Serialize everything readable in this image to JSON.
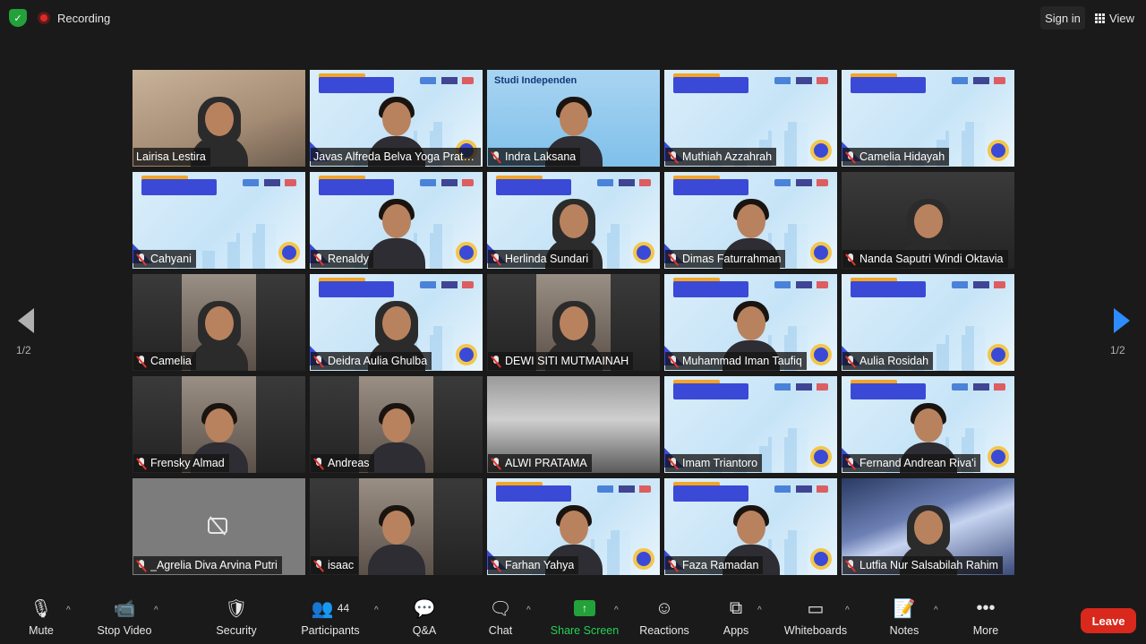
{
  "top": {
    "recording_label": "Recording",
    "signin_label": "Sign in",
    "view_label": "View"
  },
  "participants": [
    {
      "name": "Lairisa Lestira",
      "bg": "warm",
      "muted": false,
      "kind": "hijab"
    },
    {
      "name": "Javas Alfreda Belva Yoga Prata...",
      "bg": "slide",
      "muted": false,
      "kind": "person",
      "active": true
    },
    {
      "name": "Indra Laksana",
      "bg": "indra",
      "muted": true,
      "kind": "person"
    },
    {
      "name": "Muthiah Azzahrah",
      "bg": "slide",
      "muted": true,
      "kind": "none"
    },
    {
      "name": "Camelia Hidayah",
      "bg": "slide",
      "muted": true,
      "kind": "none"
    },
    {
      "name": "Cahyani",
      "bg": "slide",
      "muted": true,
      "kind": "none"
    },
    {
      "name": "Renaldy",
      "bg": "slide",
      "muted": true,
      "kind": "person"
    },
    {
      "name": "Herlinda Sundari",
      "bg": "slide",
      "muted": true,
      "kind": "hijab"
    },
    {
      "name": "Dimas Faturrahman",
      "bg": "slide",
      "muted": true,
      "kind": "person"
    },
    {
      "name": "Nanda Saputri Windi Oktavia",
      "bg": "dark",
      "muted": true,
      "kind": "hijab"
    },
    {
      "name": "Camelia",
      "bg": "cam",
      "muted": true,
      "kind": "hijab"
    },
    {
      "name": "Deidra Aulia Ghulba",
      "bg": "slide",
      "muted": true,
      "kind": "hijab"
    },
    {
      "name": "DEWI SITI MUTMAINAH",
      "bg": "cam",
      "muted": true,
      "kind": "hijab"
    },
    {
      "name": "Muhammad Iman Taufiq",
      "bg": "slide",
      "muted": true,
      "kind": "person"
    },
    {
      "name": "Aulia Rosidah",
      "bg": "slide",
      "muted": true,
      "kind": "none"
    },
    {
      "name": "Frensky Almad",
      "bg": "cam",
      "muted": true,
      "kind": "person"
    },
    {
      "name": "Andreas",
      "bg": "cam",
      "muted": true,
      "kind": "person"
    },
    {
      "name": "ALWI PRATAMA",
      "bg": "lake",
      "muted": true,
      "kind": "none"
    },
    {
      "name": "Imam Triantoro",
      "bg": "slide",
      "muted": true,
      "kind": "none"
    },
    {
      "name": "Fernand Andrean Riva'i",
      "bg": "slide",
      "muted": true,
      "kind": "person"
    },
    {
      "name": "_Agrelia Diva Arvina Putri",
      "bg": "grey",
      "muted": true,
      "kind": "camoff"
    },
    {
      "name": "isaac",
      "bg": "cam",
      "muted": true,
      "kind": "person"
    },
    {
      "name": "Farhan Yahya",
      "bg": "slide",
      "muted": true,
      "kind": "person"
    },
    {
      "name": "Faza Ramadan",
      "bg": "slide",
      "muted": true,
      "kind": "person"
    },
    {
      "name": "Lutfia Nur Salsabilah Rahim",
      "bg": "space",
      "muted": true,
      "kind": "hijab"
    }
  ],
  "indra_slide": {
    "title": "Studi Independen"
  },
  "pager": {
    "left": "1/2",
    "right": "1/2"
  },
  "toolbar": {
    "mute": "Mute",
    "stop_video": "Stop Video",
    "security": "Security",
    "participants": "Participants",
    "participant_count": "44",
    "qa": "Q&A",
    "chat": "Chat",
    "share_screen": "Share Screen",
    "reactions": "Reactions",
    "apps": "Apps",
    "whiteboards": "Whiteboards",
    "notes": "Notes",
    "more": "More",
    "leave": "Leave"
  },
  "colors": {
    "accent_green": "#23a13a",
    "leave_red": "#d9281c",
    "active_border": "#b7e24a",
    "nav_blue": "#2d8cff"
  }
}
